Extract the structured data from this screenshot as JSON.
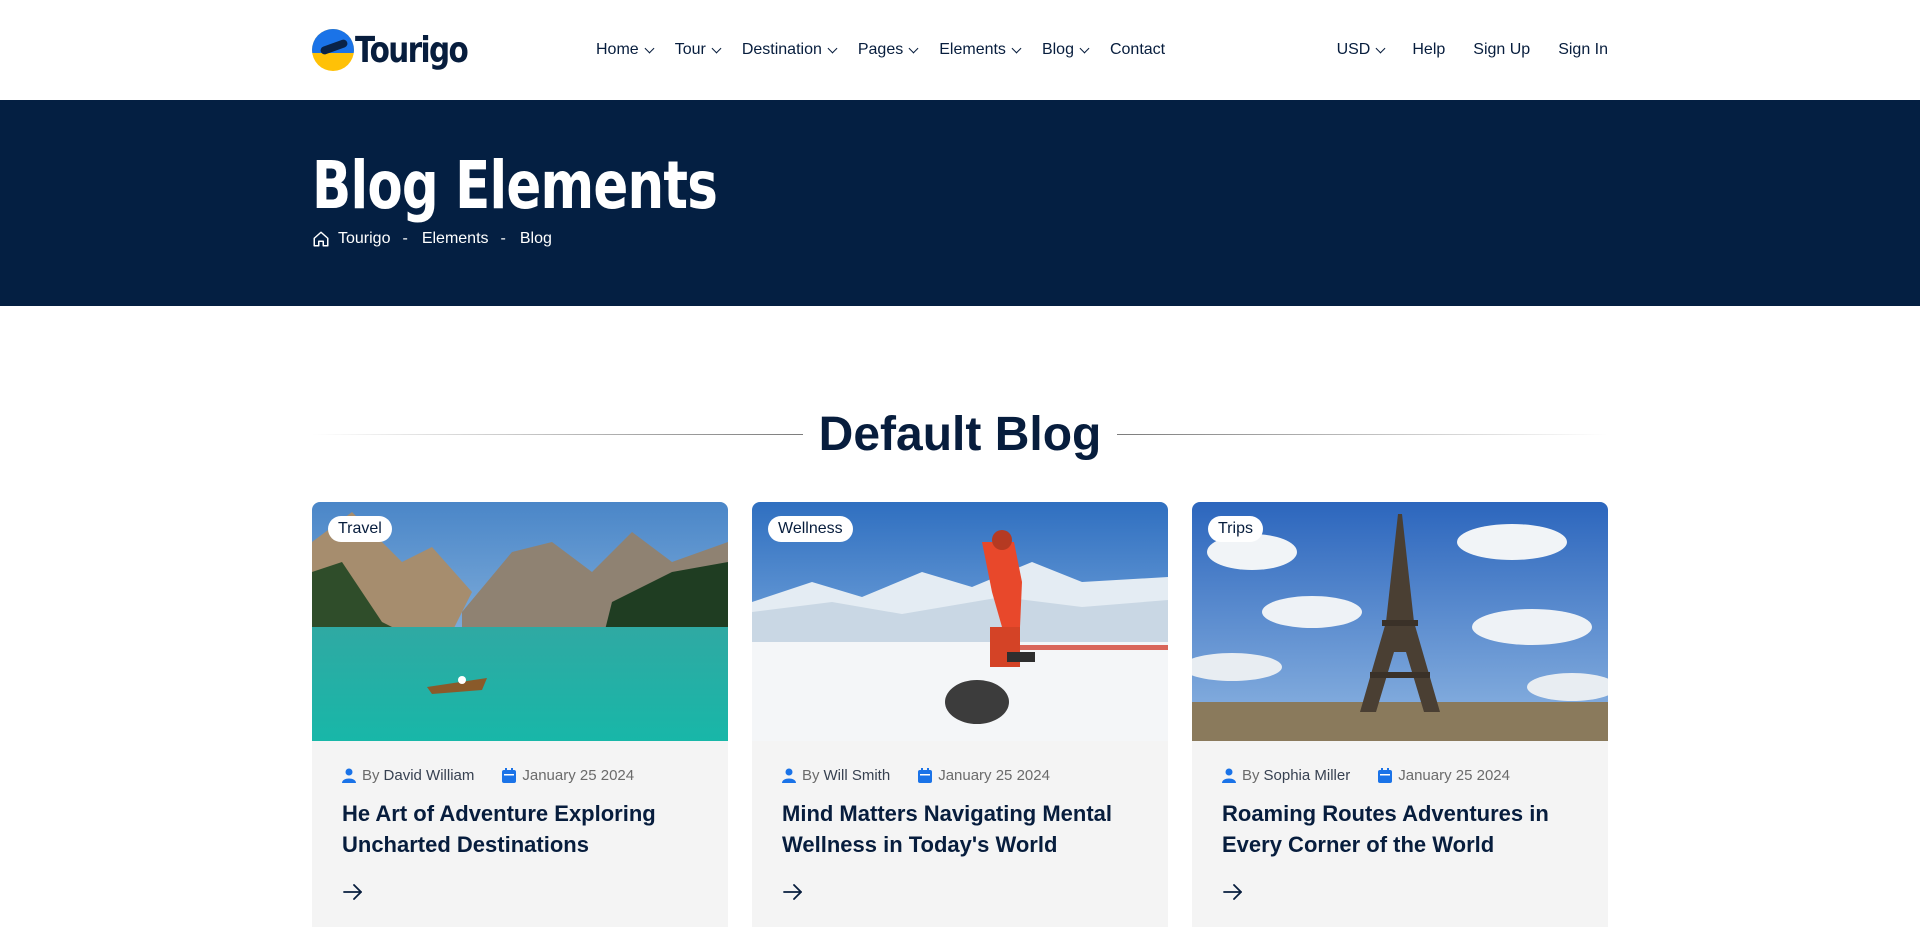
{
  "header": {
    "logo_text": "Tourigo",
    "nav": [
      {
        "label": "Home",
        "dropdown": true
      },
      {
        "label": "Tour",
        "dropdown": true
      },
      {
        "label": "Destination",
        "dropdown": true
      },
      {
        "label": "Pages",
        "dropdown": true
      },
      {
        "label": "Elements",
        "dropdown": true
      },
      {
        "label": "Blog",
        "dropdown": true
      },
      {
        "label": "Contact",
        "dropdown": false
      }
    ],
    "currency": "USD",
    "help": "Help",
    "sign_up": "Sign Up",
    "sign_in": "Sign In"
  },
  "banner": {
    "title": "Blog Elements",
    "breadcrumb": [
      "Tourigo",
      "Elements",
      "Blog"
    ],
    "separator": "-"
  },
  "section": {
    "title": "Default Blog"
  },
  "cards": [
    {
      "category": "Travel",
      "by": "By",
      "author": "David William",
      "date": "January 25 2024",
      "title": "He Art of Adventure Exploring Uncharted Destinations",
      "image": "mountain-lake"
    },
    {
      "category": "Wellness",
      "by": "By",
      "author": "Will Smith",
      "date": "January 25 2024",
      "title": "Mind Matters Navigating Mental Wellness in Today's World",
      "image": "snow-climber"
    },
    {
      "category": "Trips",
      "by": "By",
      "author": "Sophia Miller",
      "date": "January 25 2024",
      "title": "Roaming Routes Adventures in Every Corner of the World",
      "image": "eiffel-tower"
    }
  ],
  "colors": {
    "navy": "#041f42",
    "accent_blue": "#1a73e8",
    "card_bg": "#f4f4f4"
  }
}
